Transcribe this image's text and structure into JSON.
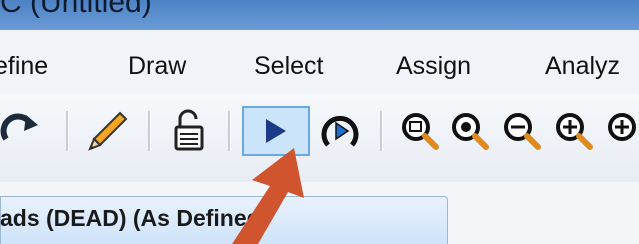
{
  "window": {
    "title": "C   (Untitled)"
  },
  "menu": {
    "items": [
      "efine",
      "Draw",
      "Select",
      "Assign",
      "Analyz"
    ]
  },
  "toolbar": {
    "buttons": [
      "redo-icon",
      "pencil-icon",
      "unlock-icon",
      "run-analysis-icon",
      "run-now-icon",
      "zoom-rubberband-icon",
      "zoom-in-icon",
      "zoom-out-icon",
      "zoom-extra-icon"
    ]
  },
  "tab": {
    "label": "ads (DEAD) (As Defined)"
  },
  "colors": {
    "accent_arrow": "#d0552f",
    "titlebar": "#5a8fd0",
    "selected_button": "#cce4fa"
  }
}
